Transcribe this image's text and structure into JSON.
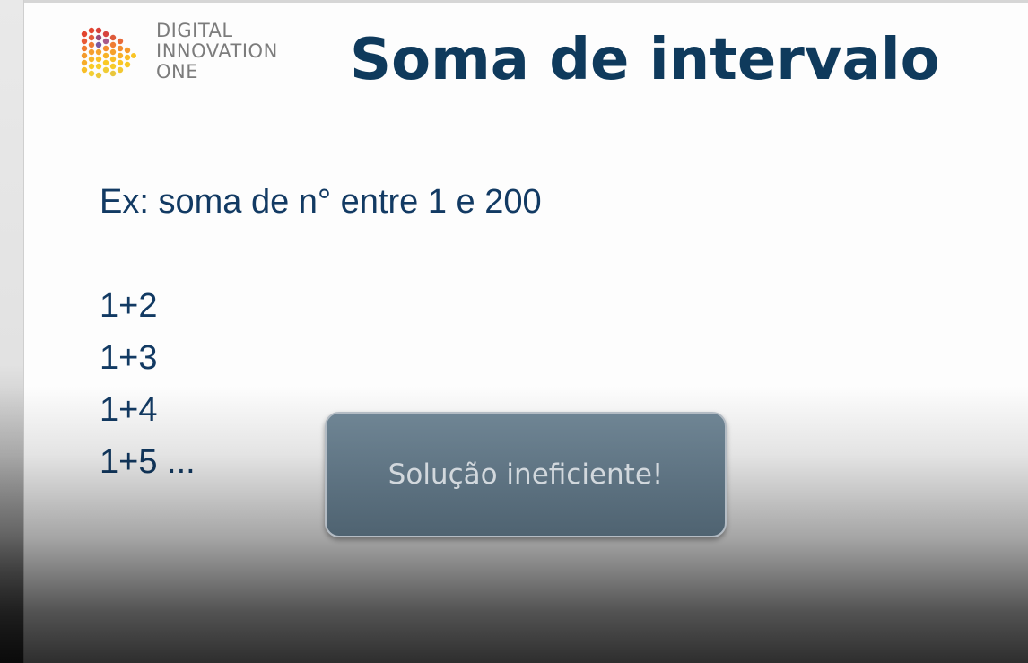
{
  "logo": {
    "lines": [
      "DIGITAL",
      "INNOVATION",
      "ONE"
    ]
  },
  "slide": {
    "title": "Soma de intervalo",
    "example": "Ex: soma de n° entre  1 e 200",
    "steps": [
      "1+2",
      "1+3",
      "1+4",
      "1+5 ..."
    ]
  },
  "callout": {
    "text": "Solução ineficiente!"
  },
  "colors": {
    "title": "#0f3a5c",
    "body_text": "#123a63",
    "logo_text": "#7c7c7c",
    "callout_fill": "#5d7281",
    "callout_text": "#d2d8dd"
  }
}
